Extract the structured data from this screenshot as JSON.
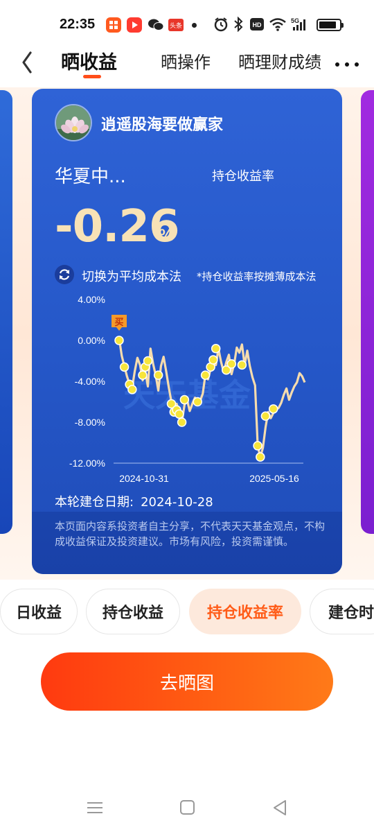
{
  "status_bar": {
    "time": "22:35",
    "app_icons": [
      {
        "name": "app-icon-1",
        "color": "#ff5a1f"
      },
      {
        "name": "video-app-icon",
        "color": "#ff3b30"
      },
      {
        "name": "wechat-icon",
        "color": "#222222"
      },
      {
        "name": "toutiao-icon",
        "color": "#e8362a",
        "label": "头条"
      }
    ],
    "network": "5G",
    "battery_level": 0.85
  },
  "header": {
    "tabs": [
      {
        "label": "晒收益",
        "active": true
      },
      {
        "label": "晒操作",
        "active": false
      },
      {
        "label": "晒理财成绩",
        "active": false
      }
    ],
    "accent_color": "#ff4d1a"
  },
  "card": {
    "username": "逍遥股海要做赢家",
    "fund_name": "华夏中...",
    "metric_label": "持仓收益率",
    "value": "-0.26",
    "unit": "%",
    "switch_label": "切换为平均成本法",
    "switch_note": "*持仓收益率按摊薄成本法",
    "build_date_label": "本轮建仓日期:",
    "build_date": "2024-10-28",
    "disclaimer": "本页面内容系投资者自主分享，不代表天天基金观点，不构成收益保证及投资建议。市场有风险，投资需谨慎。",
    "value_color": "#f8e2b6"
  },
  "chart_data": {
    "type": "line",
    "y_tick_labels": [
      "4.00%",
      "0.00%",
      "-4.00%",
      "-8.00%",
      "-12.00%"
    ],
    "ylim": [
      -12,
      4
    ],
    "x_tick_labels": [
      "2024-10-31",
      "2025-05-16"
    ],
    "buy_marker_label": "买",
    "watermark": "天天基金",
    "line_color": "#f6dcae",
    "marker_color": "#f7e53b",
    "series": [
      {
        "values": [
          0.2,
          -1.5,
          -2.5,
          -3.5,
          -4.3,
          -4.6,
          -3.0,
          -1.7,
          -2.4,
          -3.9,
          -3.0,
          -4.5,
          -0.8,
          -2.3,
          -3.4,
          -4.9,
          -2.5,
          -1.6,
          -3.0,
          -4.6,
          -6.0,
          -7.3,
          -6.2,
          -7.0,
          -8.0,
          -6.3,
          -5.8,
          -6.9,
          -6.2,
          -5.6,
          -6.3,
          -5.9,
          -5.2,
          -3.3,
          -3.8,
          -2.8,
          -1.9,
          -2.4,
          -0.8,
          -2.1,
          -3.1,
          -2.1,
          -1.4,
          -3.3,
          -2.3,
          -0.7,
          -1.2,
          -0.4,
          -2.4,
          -1.0,
          -2.5,
          -3.6,
          -4.4,
          -10.3,
          -11.4,
          -10.5,
          -8.5,
          -7.0,
          -7.6,
          -7.1,
          -6.8,
          -6.6,
          -6.1,
          -5.3,
          -4.7,
          -5.8,
          -5.1,
          -4.5,
          -4.1,
          -3.2,
          -3.5,
          -4.1
        ]
      }
    ],
    "markers": [
      {
        "i": 0,
        "v": 0.0
      },
      {
        "i": 2,
        "v": -2.6
      },
      {
        "i": 4,
        "v": -4.3
      },
      {
        "i": 5,
        "v": -4.8
      },
      {
        "i": 9,
        "v": -3.4
      },
      {
        "i": 10,
        "v": -2.6
      },
      {
        "i": 11,
        "v": -2.0
      },
      {
        "i": 15,
        "v": -3.4
      },
      {
        "i": 20,
        "v": -6.2
      },
      {
        "i": 21,
        "v": -7.0
      },
      {
        "i": 22,
        "v": -6.8
      },
      {
        "i": 23,
        "v": -7.2
      },
      {
        "i": 24,
        "v": -8.0
      },
      {
        "i": 25,
        "v": -5.8
      },
      {
        "i": 30,
        "v": -6.0
      },
      {
        "i": 33,
        "v": -3.4
      },
      {
        "i": 35,
        "v": -2.6
      },
      {
        "i": 36,
        "v": -1.9
      },
      {
        "i": 37,
        "v": -0.8
      },
      {
        "i": 41,
        "v": -2.9
      },
      {
        "i": 43,
        "v": -2.3
      },
      {
        "i": 47,
        "v": -2.4
      },
      {
        "i": 53,
        "v": -10.3
      },
      {
        "i": 54,
        "v": -11.4
      },
      {
        "i": 56,
        "v": -7.4
      },
      {
        "i": 59,
        "v": -6.7
      }
    ]
  },
  "chips": [
    {
      "label": "日收益",
      "active": false
    },
    {
      "label": "持仓收益",
      "active": false
    },
    {
      "label": "持仓收益率",
      "active": true
    },
    {
      "label": "建仓时",
      "active": false
    }
  ],
  "primary_button": {
    "label": "去晒图"
  }
}
